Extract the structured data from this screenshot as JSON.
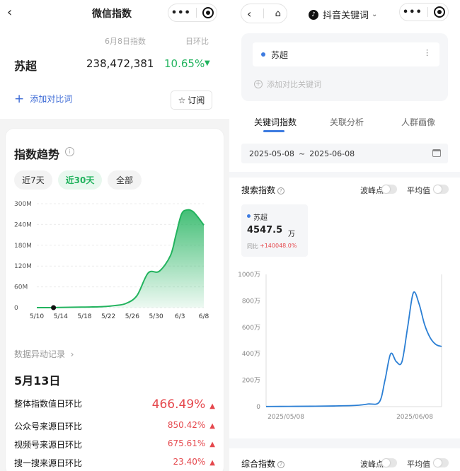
{
  "left": {
    "header": {
      "title": "微信指数",
      "back_icon": "chevron-left-icon",
      "more_icon": "more-dots-icon",
      "close_icon": "target-close-icon"
    },
    "summary": {
      "col_date_label": "6月8日指数",
      "col_change_label": "日环比",
      "keyword": "苏超",
      "index_value": "238,472,381",
      "change_value": "10.65%",
      "change_direction": "down"
    },
    "add_compare_label": "添加对比词",
    "subscribe_label": "订阅",
    "trend": {
      "title": "指数趋势",
      "ranges": [
        "近7天",
        "近30天",
        "全部"
      ],
      "active_range": "近30天"
    },
    "anomaly": {
      "link_label": "数据异动记录",
      "date": "5月13日",
      "rows": [
        {
          "label": "整体指数值日环比",
          "value": "466.49%"
        },
        {
          "label": "公众号来源日环比",
          "value": "850.42%"
        },
        {
          "label": "视频号来源日环比",
          "value": "675.61%"
        },
        {
          "label": "搜一搜来源日环比",
          "value": "23.40%"
        }
      ]
    }
  },
  "right": {
    "header": {
      "app_name": "抖音关键词",
      "back_icon": "chevron-left-icon",
      "home_icon": "home-icon",
      "tiktok_icon": "tiktok-logo-icon"
    },
    "keyword_box": {
      "keyword": "苏超",
      "add_label": "添加对比关键词"
    },
    "tabs": [
      "关键词指数",
      "关联分析",
      "人群画像"
    ],
    "active_tab": "关键词指数",
    "date_range": {
      "start": "2025-05-08",
      "sep": "~",
      "end": "2025-06-08"
    },
    "search_index": {
      "title": "搜索指数",
      "peak_label": "波峰点",
      "avg_label": "平均值",
      "tooltip": {
        "keyword": "苏超",
        "value": "4547.5",
        "unit": "万",
        "change_label": "同比",
        "change_value": "+140048.0%"
      }
    },
    "overall_index": {
      "title": "综合指数",
      "peak_label": "波峰点",
      "avg_label": "平均值"
    }
  },
  "chart_data": [
    {
      "type": "area",
      "title": "指数趋势",
      "categories": [
        "5/10",
        "5/14",
        "5/18",
        "5/22",
        "5/26",
        "5/30",
        "6/3",
        "6/8"
      ],
      "y_tick_labels": [
        "0",
        "60M",
        "120M",
        "180M",
        "240M",
        "300M"
      ],
      "ylim": [
        0,
        300
      ],
      "y_unit": "M",
      "x": [
        0,
        2,
        4,
        6,
        8,
        10,
        12,
        14,
        16,
        18,
        20,
        22,
        24,
        25,
        26,
        27,
        28,
        29,
        30
      ],
      "series": [
        {
          "values": [
            0,
            0,
            0.5,
            1,
            1.5,
            2,
            3,
            6,
            12,
            35,
            100,
            105,
            150,
            210,
            270,
            282,
            278,
            260,
            238
          ]
        }
      ],
      "marker": {
        "x": 3,
        "label": "5/13"
      },
      "color": "#22b35e"
    },
    {
      "type": "line",
      "title": "搜索指数",
      "x_tick_labels": [
        "2025/05/08",
        "2025/06/08"
      ],
      "y_tick_labels": [
        "0",
        "200万",
        "400万",
        "600万",
        "800万",
        "1000万"
      ],
      "ylim": [
        0,
        1000
      ],
      "y_unit": "万",
      "x": [
        0,
        4,
        8,
        12,
        16,
        18,
        20,
        21,
        22,
        23,
        24,
        25,
        26,
        27,
        28,
        29,
        30,
        31
      ],
      "series": [
        {
          "name": "苏超",
          "values": [
            1,
            2,
            3,
            5,
            10,
            20,
            35,
            200,
            400,
            340,
            340,
            600,
            860,
            780,
            620,
            520,
            470,
            455
          ]
        }
      ],
      "color": "#2b7fd4"
    }
  ]
}
